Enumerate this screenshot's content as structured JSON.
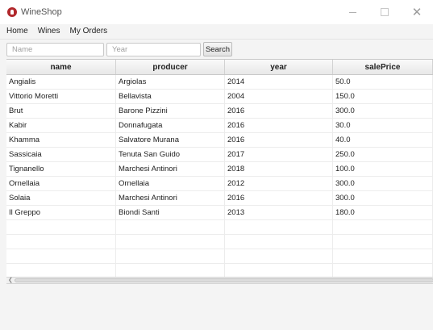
{
  "window": {
    "title": "WineShop",
    "minimize_symbol": "—",
    "close_symbol": "✕"
  },
  "menu": {
    "items": [
      "Home",
      "Wines",
      "My Orders"
    ]
  },
  "search": {
    "name_placeholder": "Name",
    "year_placeholder": "Year",
    "button_label": "Search"
  },
  "table": {
    "columns": [
      "name",
      "producer",
      "year",
      "salePrice"
    ],
    "rows": [
      [
        "Angialis",
        "Argiolas",
        "2014",
        "50.0"
      ],
      [
        "Vittorio Moretti",
        "Bellavista",
        "2004",
        "150.0"
      ],
      [
        "Brut",
        "Barone Pizzini",
        "2016",
        "300.0"
      ],
      [
        "Kabir",
        "Donnafugata",
        "2016",
        "30.0"
      ],
      [
        "Khamma",
        "Salvatore Murana",
        "2016",
        "40.0"
      ],
      [
        "Sassicaia",
        "Tenuta San Guido",
        "2017",
        "250.0"
      ],
      [
        "Tignanello",
        "Marchesi Antinori",
        "2018",
        "100.0"
      ],
      [
        "Ornellaia",
        "Ornellaia",
        "2012",
        "300.0"
      ],
      [
        "Solaia",
        "Marchesi Antinori",
        "2016",
        "300.0"
      ],
      [
        "Il Greppo",
        "Biondi Santi",
        "2013",
        "180.0"
      ]
    ]
  },
  "icons": {
    "app": "wine-logo-icon",
    "scroll_left": "chevron-left-icon"
  },
  "colors": {
    "app_icon": "#b1282c",
    "header_bg": "#e8e8e8",
    "window_bg": "#f4f4f4"
  }
}
